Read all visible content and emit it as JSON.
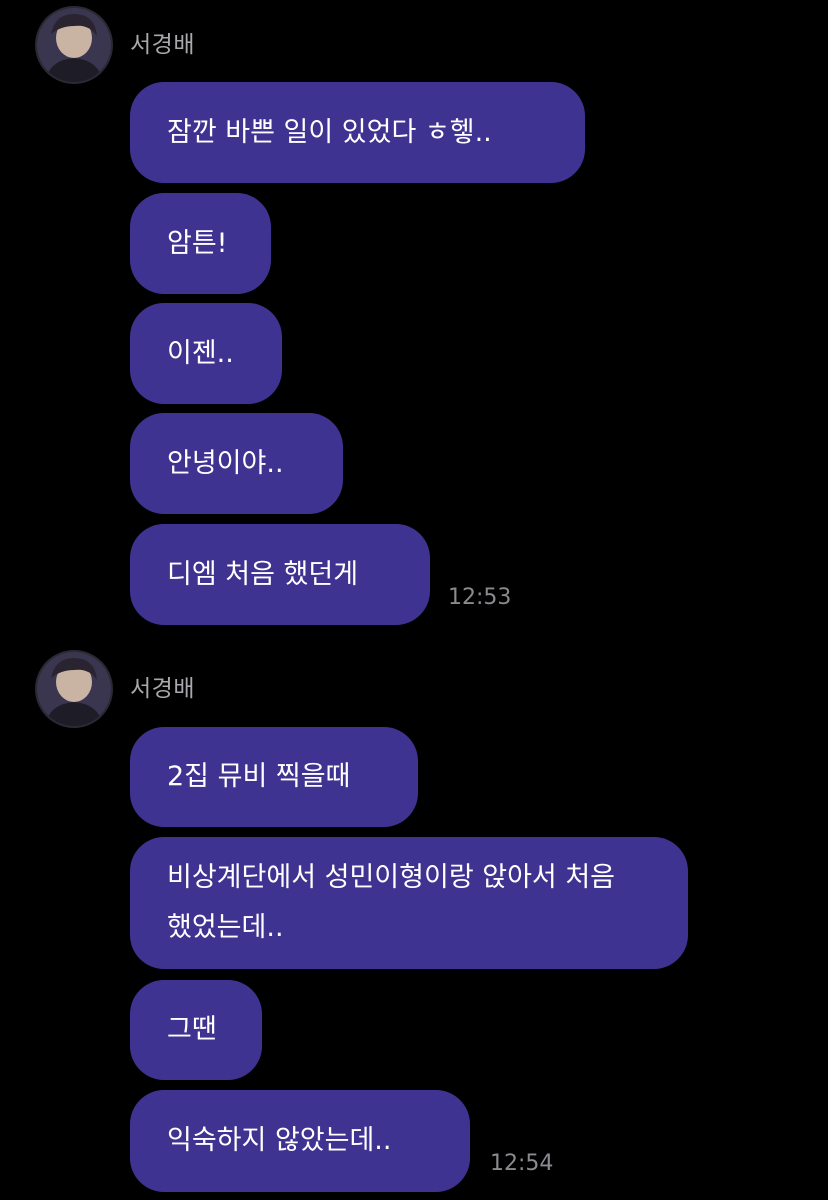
{
  "groups": [
    {
      "sender": "서경배",
      "messages": [
        "잠깐 바쁜 일이 있었다 ㅎ헿..",
        "암튼!",
        "이젠..",
        "안녕이야..",
        "디엠 처음 했던게"
      ],
      "time": "12:53"
    },
    {
      "sender": "서경배",
      "messages": [
        "2집 뮤비 찍을때",
        "비상계단에서 성민이형이랑 앉아서 처음 했었는데..",
        "그땐",
        "익숙하지 않았는데.."
      ],
      "time": "12:54"
    }
  ],
  "colors": {
    "background": "#000000",
    "bubble": "#3f3391",
    "bubble_text": "#ffffff",
    "sender_text": "#a9a9ad",
    "time_text": "#8a8a8f"
  },
  "icons": {
    "avatar": "user-profile-photo"
  }
}
